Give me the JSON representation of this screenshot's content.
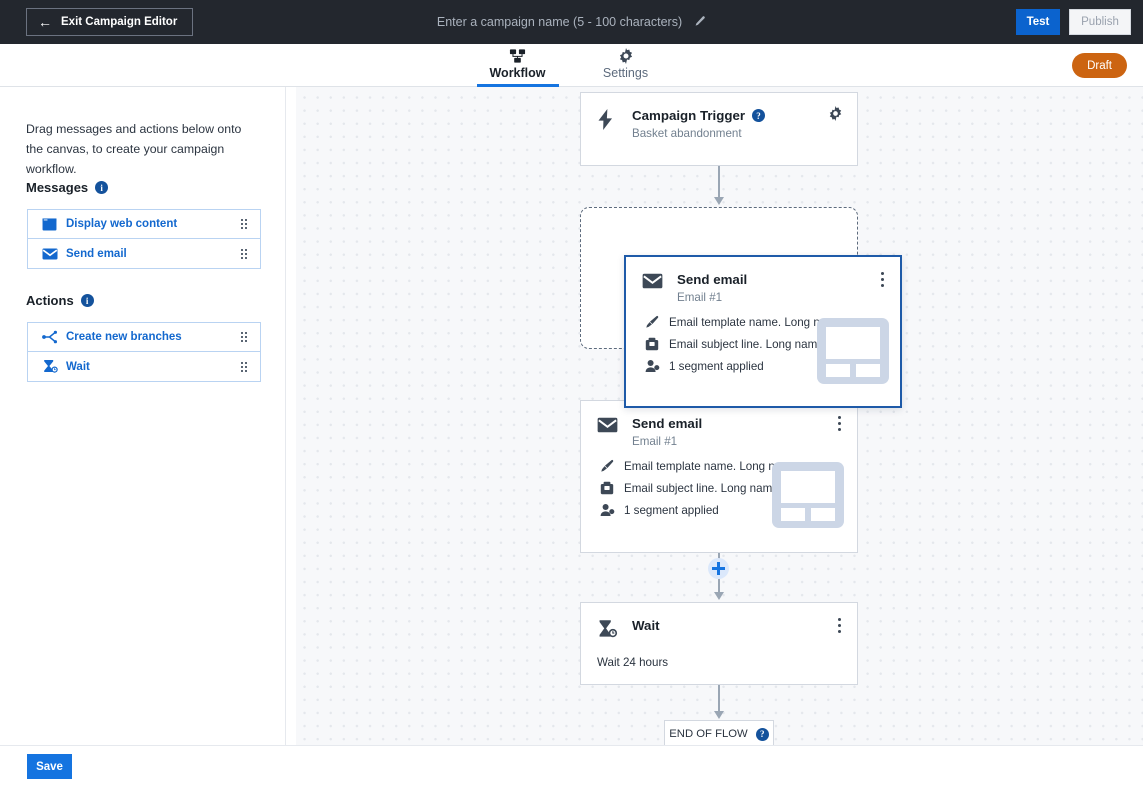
{
  "topbar": {
    "exit_label": "Exit Campaign Editor",
    "back_icon": "arrow-left-icon",
    "campaign_name_placeholder": "Enter a campaign name (5 - 100 characters)",
    "campaign_name_value": "",
    "edit_icon": "pencil-icon",
    "test_label": "Test",
    "publish_label": "Publish",
    "bg_color": "#23272e",
    "accent_color": "#0b63ce"
  },
  "tabbar": {
    "tabs": [
      {
        "label": "Workflow",
        "icon": "workflow-icon",
        "active": true
      },
      {
        "label": "Settings",
        "icon": "gear-icon",
        "active": false
      }
    ],
    "status_badge": "Draft",
    "status_badge_color": "#cc6411",
    "active_tab_color": "#1574e0"
  },
  "sidebar": {
    "intro": "Drag messages and actions below onto the canvas, to create your campaign workflow.",
    "groups": [
      {
        "title": "Messages",
        "info_icon": "info-icon",
        "items": [
          {
            "label": "Display web content",
            "icon": "web-content-icon",
            "grip": "drag-handle-icon"
          },
          {
            "label": "Send email",
            "icon": "envelope-icon",
            "grip": "drag-handle-icon"
          }
        ]
      },
      {
        "title": "Actions",
        "info_icon": "info-icon",
        "items": [
          {
            "label": "Create new branches",
            "icon": "branch-icon",
            "grip": "drag-handle-icon"
          },
          {
            "label": "Wait",
            "icon": "hourglass-icon",
            "grip": "drag-handle-icon"
          }
        ]
      }
    ],
    "link_color": "#1368ce"
  },
  "footer": {
    "save_label": "Save"
  },
  "canvas": {
    "trigger": {
      "title": "Campaign Trigger",
      "help_icon": "help-icon",
      "subtitle": "Basket abandonment",
      "icon": "lightning-bolt-icon",
      "settings_icon": "gear-icon"
    },
    "dropzone": {
      "label": ""
    },
    "email_static": {
      "title": "Send email",
      "subtitle": "Email #1",
      "icon": "envelope-icon",
      "menu_icon": "kebab-menu-icon",
      "meta": [
        {
          "icon": "brush-icon",
          "text": "Email template name. Long n..."
        },
        {
          "icon": "subject-icon",
          "text": "Email subject line. Long nam..."
        },
        {
          "icon": "segment-icon",
          "text": "1 segment applied"
        }
      ],
      "thumbnail": "email-layout-thumbnail"
    },
    "email_drag": {
      "title": "Send email",
      "subtitle": "Email #1",
      "icon": "envelope-icon",
      "menu_icon": "kebab-menu-icon",
      "meta": [
        {
          "icon": "brush-icon",
          "text": "Email template name. Long n..."
        },
        {
          "icon": "subject-icon",
          "text": "Email subject line. Long nam..."
        },
        {
          "icon": "segment-icon",
          "text": "1 segment applied"
        }
      ],
      "thumbnail": "email-layout-thumbnail"
    },
    "wait": {
      "title": "Wait",
      "icon": "hourglass-icon",
      "menu_icon": "kebab-menu-icon",
      "detail": "Wait 24 hours"
    },
    "add_step_icon": "plus-icon",
    "end_of_flow": {
      "label": "END OF FLOW",
      "help_icon": "help-icon"
    },
    "connector_color": "#9aa6b4",
    "grid_dot_color": "#e4e7ec"
  }
}
